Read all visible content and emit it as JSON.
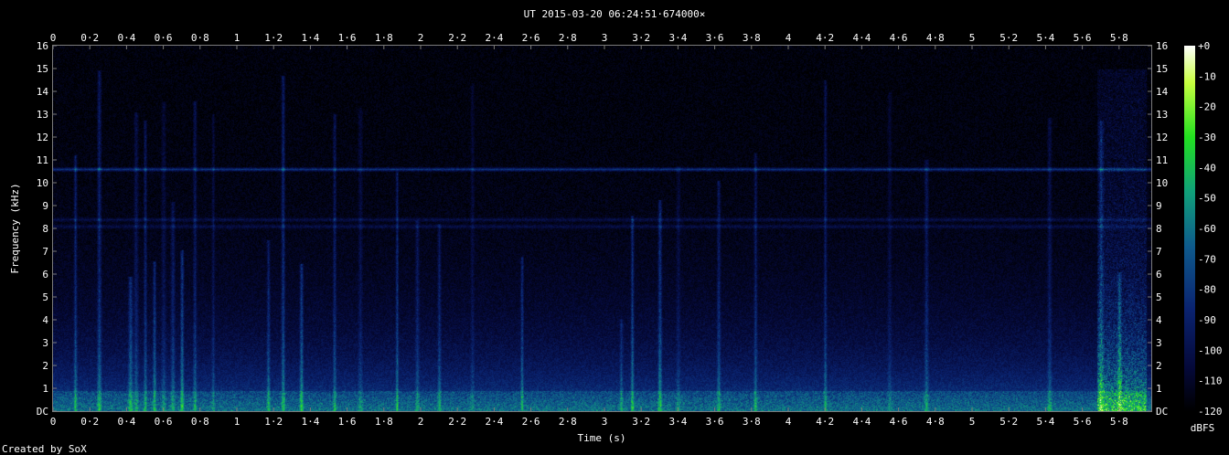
{
  "chart_data": {
    "type": "heatmap",
    "title": "UT 2015-03-20 06:24:51·674000×",
    "xlabel": "Time (s)",
    "ylabel": "Frequency (kHz)",
    "footer": "Created by SoX",
    "colorbar_label": "dBFS",
    "xlim": [
      0,
      5.98
    ],
    "ylim": [
      0,
      16
    ],
    "x_ticks": [
      "0",
      "0·2",
      "0·4",
      "0·6",
      "0·8",
      "1",
      "1·2",
      "1·4",
      "1·6",
      "1·8",
      "2",
      "2·2",
      "2·4",
      "2·6",
      "2·8",
      "3",
      "3·2",
      "3·4",
      "3·6",
      "3·8",
      "4",
      "4·2",
      "4·4",
      "4·6",
      "4·8",
      "5",
      "5·2",
      "5·4",
      "5·6",
      "5·8"
    ],
    "y_ticks": [
      "DC",
      "1",
      "2",
      "3",
      "4",
      "5",
      "6",
      "7",
      "8",
      "9",
      "10",
      "11",
      "12",
      "13",
      "14",
      "15",
      "16"
    ],
    "colorbar_ticks": [
      "+0",
      "-10",
      "-20",
      "-30",
      "-40",
      "-50",
      "-60",
      "-70",
      "-80",
      "-90",
      "-100",
      "-110",
      "-120"
    ],
    "colormap": [
      "#000000",
      "#05093a",
      "#0a2370",
      "#0e5a8c",
      "#10a07a",
      "#22e020",
      "#c8ff40",
      "#ffffff"
    ],
    "spectral_lines_khz": [
      10.6,
      8.4,
      8.1
    ],
    "impulse_times_s": [
      0.12,
      0.25,
      0.42,
      0.45,
      0.5,
      0.55,
      0.6,
      0.65,
      0.7,
      0.77,
      0.87,
      1.17,
      1.25,
      1.35,
      1.53,
      1.67,
      1.87,
      1.98,
      2.1,
      2.28,
      2.55,
      3.09,
      3.15,
      3.3,
      3.4,
      3.62,
      3.82,
      4.2,
      4.55,
      4.75,
      5.42,
      5.7,
      5.8
    ],
    "broadband_event_s": [
      5.68,
      5.9
    ]
  }
}
